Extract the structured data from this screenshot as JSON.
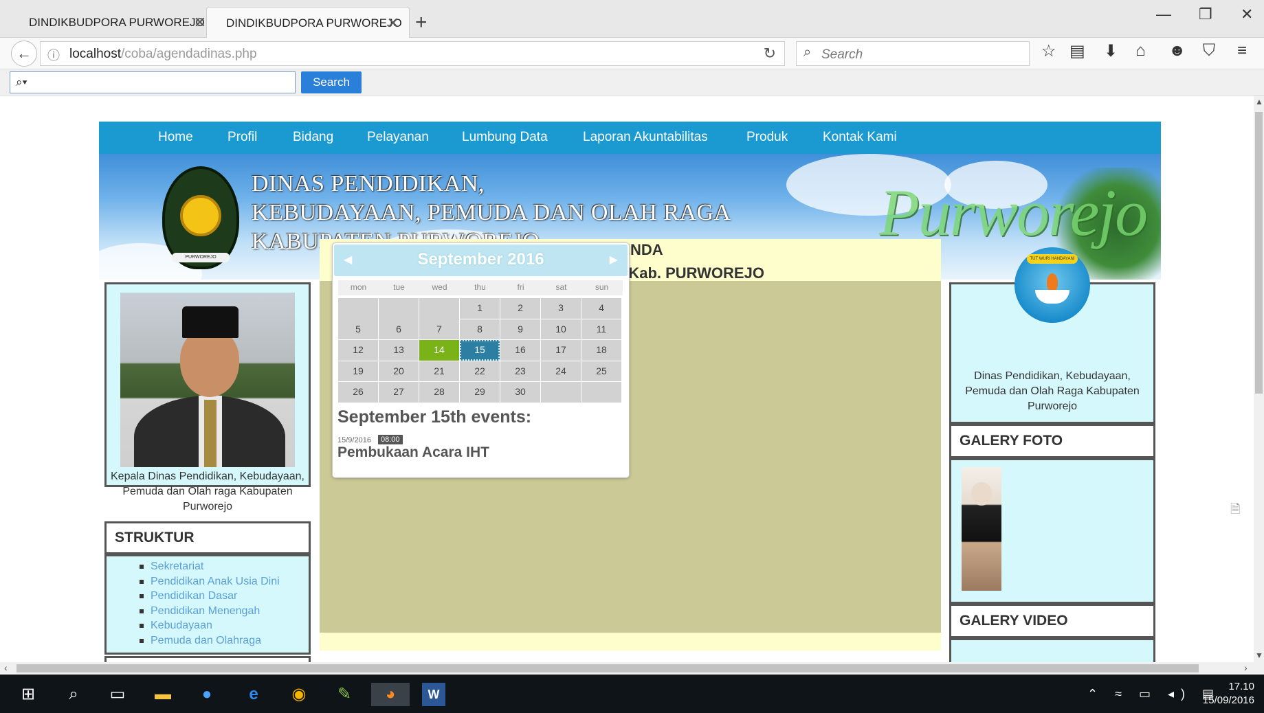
{
  "browser": {
    "tabs": [
      {
        "title": "DINDIKBUDPORA PURWOREJO",
        "active": false
      },
      {
        "title": "DINDIKBUDPORA PURWOREJO",
        "active": true
      }
    ],
    "new_tab": "+",
    "window_controls": {
      "minimize": "—",
      "restore": "❐",
      "close": "✕"
    },
    "url_host": "localhost",
    "url_path": "/coba/agendadinas.php",
    "search_placeholder": "Search",
    "toolbar_icons": [
      "star-icon",
      "reading-list-icon",
      "download-icon",
      "home-icon",
      "chat-icon",
      "pocket-icon",
      "menu-icon"
    ],
    "find_button": "Search",
    "find_prefix": "⌕▾"
  },
  "site": {
    "menu": [
      "Home",
      "Profil",
      "Bidang",
      "Pelayanan",
      "Lumbung Data",
      "Laporan Akuntabilitas",
      "Produk",
      "Kontak Kami"
    ],
    "banner": {
      "line1": "DINAS PENDIDIKAN,",
      "line2": "KEBUDAYAAN, PEMUDA DAN OLAH RAGA",
      "line3": "KABUPATEN PURWOREJO",
      "city_sign": "Purworejo",
      "emblem_ribbon": "PURWOREJO"
    },
    "left": {
      "caption": "Kepala Dinas Pendidikan, Kebudayaan, Pemuda dan Olah raga Kabupaten Purworejo",
      "struktur_title": "STRUKTUR",
      "struktur_items": [
        "Sekretariat",
        "Pendidikan Anak Usia Dini",
        "Pendidikan Dasar",
        "Pendidikan Menengah",
        "Kebudayaan",
        "Pemuda dan Olahraga"
      ]
    },
    "agenda": {
      "title": "AGENDA",
      "subtitle": "DINDIKBUDPORA Kab. PURWOREJO",
      "calendar": {
        "month": "September 2016",
        "weekdays": [
          "mon",
          "tue",
          "wed",
          "thu",
          "fri",
          "sat",
          "sun"
        ],
        "days": [
          "1",
          "2",
          "3",
          "4",
          "5",
          "6",
          "7",
          "8",
          "9",
          "10",
          "11",
          "12",
          "13",
          "14",
          "15",
          "16",
          "17",
          "18",
          "19",
          "20",
          "21",
          "22",
          "23",
          "24",
          "25",
          "26",
          "27",
          "28",
          "29",
          "30"
        ],
        "today": "14",
        "selected": "15"
      },
      "events_title": "September 15th events:",
      "event_date": "15/9/2016",
      "event_time": "08:00",
      "event_name": "Pembukaan Acara IHT"
    },
    "right": {
      "logo_motto": "TUT WURI HANDAYANI",
      "caption": "Dinas Pendidikan, Kebudayaan, Pemuda dan Olah Raga Kabupaten Purworejo",
      "galery_foto": "GALERY FOTO",
      "galery_video": "GALERY VIDEO"
    }
  },
  "taskbar": {
    "time": "17.10",
    "date": "15/09/2016"
  }
}
